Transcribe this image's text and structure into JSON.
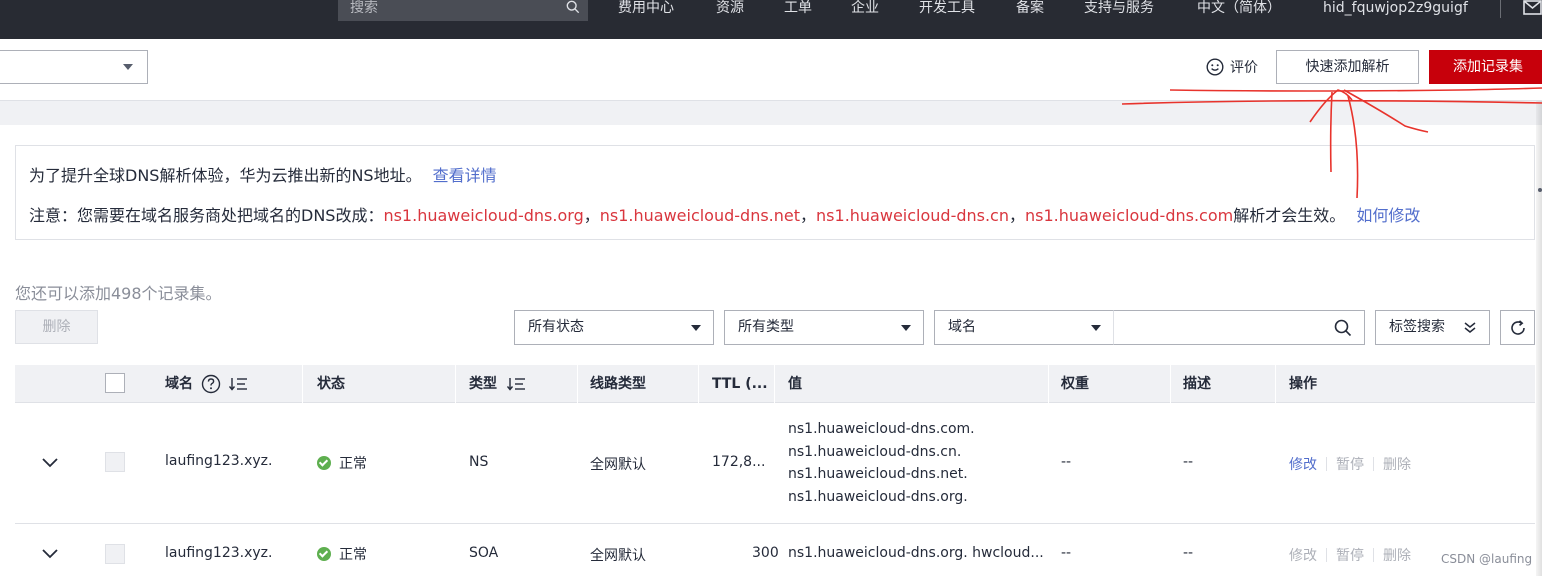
{
  "topnav": {
    "search_placeholder": "搜索",
    "items": [
      "费用中心",
      "资源",
      "工单",
      "企业",
      "开发工具",
      "备案",
      "支持与服务",
      "中文（简体）",
      "hid_fquwjop2z9guigf"
    ]
  },
  "toolbar": {
    "rate_label": "评价",
    "quick_add_label": "快速添加解析",
    "add_record_label": "添加记录集"
  },
  "notice": {
    "line1_text": "为了提升全球DNS解析体验，华为云推出新的NS地址。",
    "line1_link": "查看详情",
    "line2_prefix": "注意：您需要在域名服务商处把域名的DNS改成：",
    "ns": [
      "ns1.huaweicloud-dns.org",
      "ns1.huaweicloud-dns.net",
      "ns1.huaweicloud-dns.cn",
      "ns1.huaweicloud-dns.com"
    ],
    "comma": "，",
    "line2_suffix": "解析才会生效。",
    "line2_link": "如何修改"
  },
  "remain_text": "您还可以添加498个记录集。",
  "filters": {
    "delete_label": "删除",
    "status_select": "所有状态",
    "type_select": "所有类型",
    "field_select": "域名",
    "tag_search_label": "标签搜索"
  },
  "table": {
    "headers": {
      "domain": "域名",
      "status": "状态",
      "type": "类型",
      "line": "线路类型",
      "ttl": "TTL (...",
      "value": "值",
      "weight": "权重",
      "desc": "描述",
      "ops": "操作"
    },
    "rows": [
      {
        "domain": "laufing123.xyz.",
        "status": "正常",
        "type": "NS",
        "line": "全网默认",
        "ttl": "172,8...",
        "values": [
          "ns1.huaweicloud-dns.com.",
          "ns1.huaweicloud-dns.cn.",
          "ns1.huaweicloud-dns.net.",
          "ns1.huaweicloud-dns.org."
        ],
        "weight": "--",
        "desc": "--",
        "ops": [
          "修改",
          "暂停",
          "删除"
        ]
      },
      {
        "domain": "laufing123.xyz.",
        "status": "正常",
        "type": "SOA",
        "line": "全网默认",
        "ttl": "300",
        "values": [
          "ns1.huaweicloud-dns.org. hwcloud..."
        ],
        "weight": "--",
        "desc": "--",
        "ops": [
          "修改",
          "暂停",
          "删除"
        ]
      }
    ]
  },
  "watermark": "CSDN @laufing",
  "colors": {
    "nav_bg": "#282b33",
    "brand_red": "#c7000b",
    "link_blue": "#526ecc",
    "ns_red": "#d9363e",
    "status_green": "#5eaf4f",
    "annotation_red": "#e8332c"
  }
}
